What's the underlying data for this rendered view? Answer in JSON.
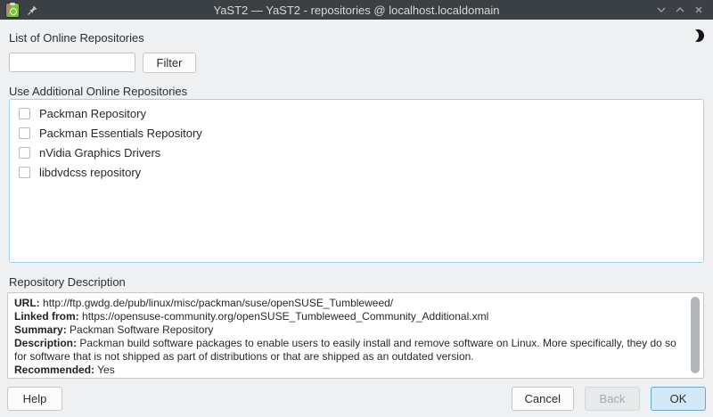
{
  "window": {
    "title": "YaST2 — YaST2 - repositories @ localhost.localdomain"
  },
  "colors": {
    "titlebar_bg": "#3b4045",
    "window_bg": "#eff0f1",
    "focus_blue": "#9fd1ee",
    "ok_button_bg": "#d3e9f5",
    "yast_green": "#7dc141"
  },
  "main": {
    "list_label": "List of Online Repositories",
    "filter": {
      "input_value": "",
      "button_label": "Filter"
    },
    "repos_label": "Use Additional Online Repositories",
    "repositories": [
      {
        "label": "Packman Repository",
        "checked": false
      },
      {
        "label": "Packman Essentials Repository",
        "checked": false
      },
      {
        "label": "nVidia Graphics Drivers",
        "checked": false
      },
      {
        "label": "libdvdcss repository",
        "checked": false
      }
    ],
    "description_label": "Repository Description",
    "description": {
      "url_label": "URL:",
      "url": "http://ftp.gwdg.de/pub/linux/misc/packman/suse/openSUSE_Tumbleweed/",
      "linked_label": "Linked from:",
      "linked": "https://opensuse-community.org/openSUSE_Tumbleweed_Community_Additional.xml",
      "summary_label": "Summary:",
      "summary": "Packman Software Repository",
      "desc_label": "Description:",
      "desc": "Packman build software packages to enable users to easily install and remove software on Linux. More specifically, they do so for software that is not shipped as part of distributions or that are shipped as an outdated version.",
      "recommended_label": "Recommended:",
      "recommended": "Yes"
    }
  },
  "footer": {
    "help_label": "Help",
    "cancel_label": "Cancel",
    "back_label": "Back",
    "ok_label": "OK"
  }
}
